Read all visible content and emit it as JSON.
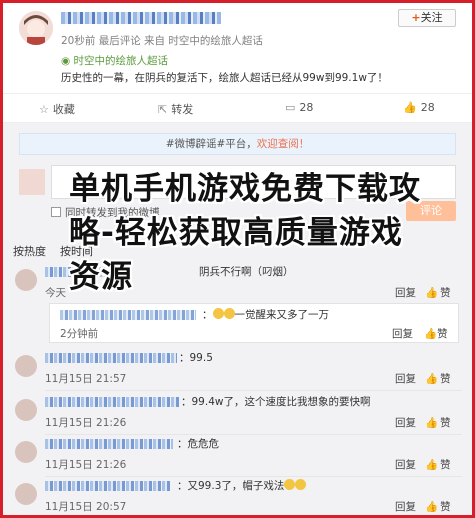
{
  "post": {
    "meta": "20秒前 最后评论 来自 时空中的绘旅人超话",
    "topic": "时空中的绘旅人超话",
    "text": "历史性的一幕，在阴兵的复活下，绘旅人超话已经从99w到99.1w了！",
    "follow_label": "关注"
  },
  "actions": {
    "collect": "收藏",
    "forward": "转发",
    "comment_count": "28",
    "like_count": "28"
  },
  "comment_box": {
    "hint_prefix": "#微博辟谣#平台，",
    "hint_link": "欢迎查阅！",
    "forward_label": "同时转发到我的微博",
    "submit_label": "评论"
  },
  "sort": {
    "hot": "按热度",
    "time": "按时间"
  },
  "headline": "单机手机游戏免费下载攻略-轻松获取高质量游戏资源",
  "comments": [
    {
      "text": "阴兵不行啊（叼烟）",
      "time": "今天",
      "reply": "回复",
      "like": "赞"
    },
    {
      "text": "99.5",
      "time": "11月15日 21:57",
      "reply": "回复",
      "like": "赞"
    },
    {
      "text": "99.4w了，这个速度比我想象的要快啊",
      "time": "11月15日 21:26",
      "reply": "回复",
      "like": "赞"
    },
    {
      "text": "危危危",
      "time": "11月15日 21:26",
      "reply": "回复",
      "like": "赞"
    },
    {
      "text": "又99.3了，帽子戏法",
      "time": "11月15日 20:57",
      "reply": "回复",
      "like": "赞"
    }
  ],
  "subreply": {
    "text": "一觉醒来又多了一万",
    "time": "2分钟前",
    "reply": "回复",
    "like": "赞"
  },
  "colors": {
    "frame": "#d71e2b",
    "topic": "#5b9a3c",
    "submit": "#ffbf99",
    "link": "#eb7350"
  }
}
